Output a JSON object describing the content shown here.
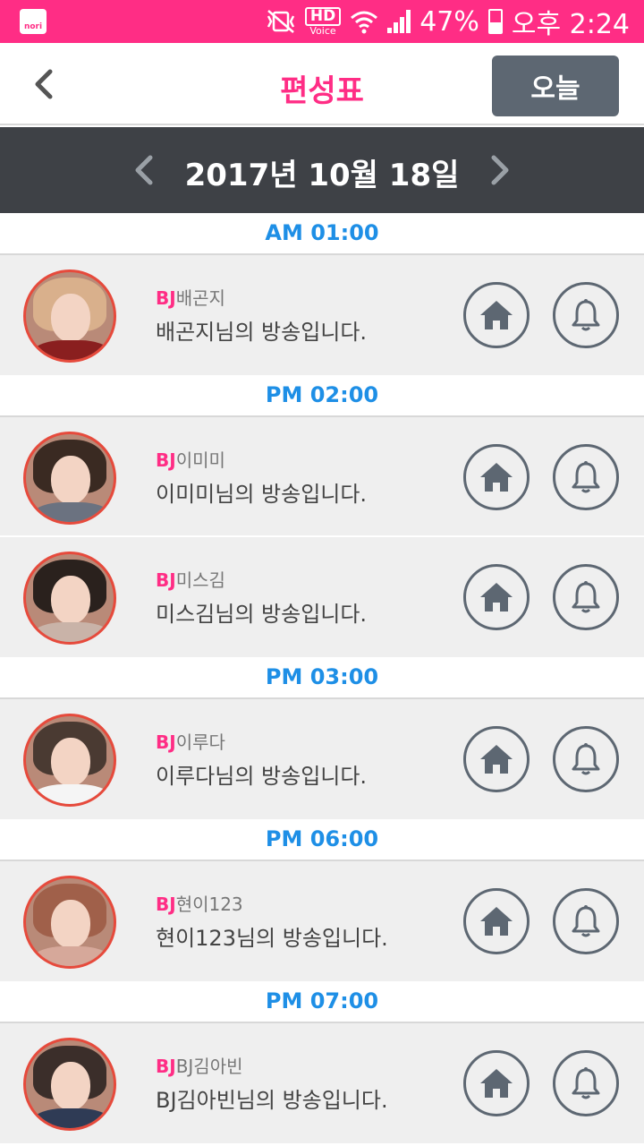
{
  "status_bar": {
    "app_icon_label": "nori",
    "hd": "HD",
    "voice": "Voice",
    "battery": "47%",
    "time": "오후 2:24"
  },
  "header": {
    "title": "편성표",
    "today_button": "오늘"
  },
  "date_bar": {
    "date": "2017년 10월 18일"
  },
  "colors": {
    "accent_pink": "#ff2d85",
    "time_blue": "#1e8fe6",
    "date_bar_bg": "#3e4146",
    "button_gray": "#5d6772"
  },
  "schedule": [
    {
      "time": "AM 01:00",
      "entries": [
        {
          "bj_prefix": "BJ",
          "name": "배곤지",
          "description": "배곤지님의 방송입니다.",
          "avatar_hair": "#d9b08c",
          "avatar_body": "#8a1f1f"
        }
      ]
    },
    {
      "time": "PM 02:00",
      "entries": [
        {
          "bj_prefix": "BJ",
          "name": "이미미",
          "description": "이미미님의 방송입니다.",
          "avatar_hair": "#3a2a22",
          "avatar_body": "#6b7280"
        },
        {
          "bj_prefix": "BJ",
          "name": "미스김",
          "description": "미스김님의 방송입니다.",
          "avatar_hair": "#2a211d",
          "avatar_body": "#c9b3a8"
        }
      ]
    },
    {
      "time": "PM 03:00",
      "entries": [
        {
          "bj_prefix": "BJ",
          "name": "이루다",
          "description": "이루다님의 방송입니다.",
          "avatar_hair": "#4a3a32",
          "avatar_body": "#f5f5f5"
        }
      ]
    },
    {
      "time": "PM 06:00",
      "entries": [
        {
          "bj_prefix": "BJ",
          "name": "현이123",
          "description": "현이123님의 방송입니다.",
          "avatar_hair": "#a0604a",
          "avatar_body": "#d6a89a"
        }
      ]
    },
    {
      "time": "PM 07:00",
      "entries": [
        {
          "bj_prefix": "BJ",
          "name": "BJ김아빈",
          "description": "BJ김아빈님의 방송입니다.",
          "avatar_hair": "#3b2e2a",
          "avatar_body": "#2f3b55"
        }
      ]
    }
  ]
}
